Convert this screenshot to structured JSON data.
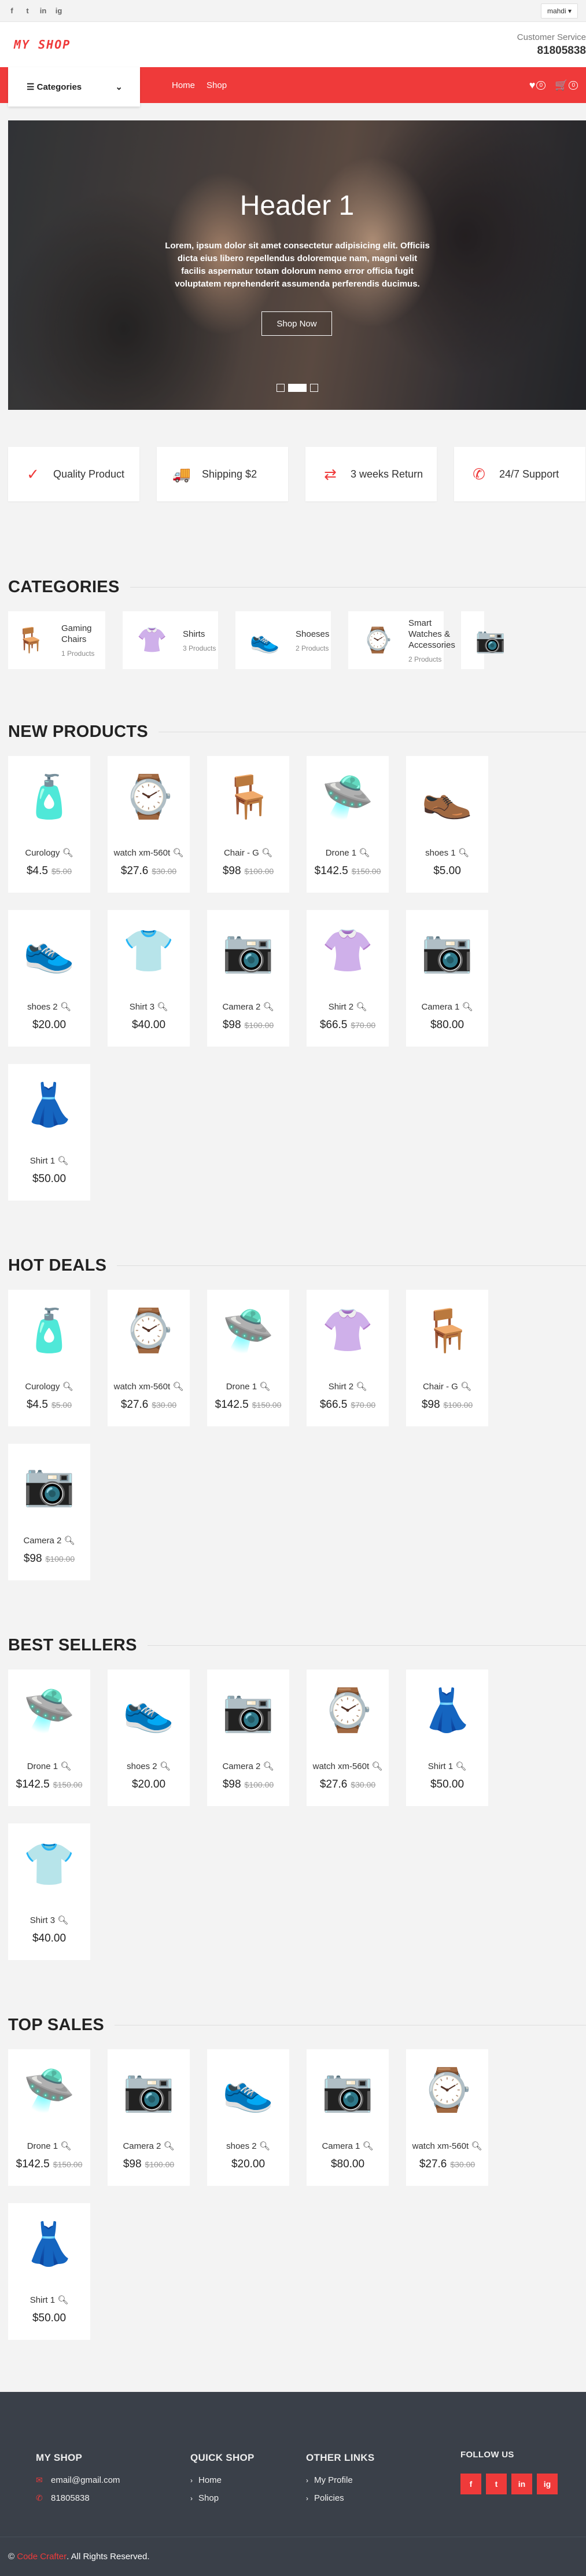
{
  "topbar": {
    "social": [
      "f",
      "t",
      "in",
      "ig"
    ],
    "user_label": "mahdi ▾"
  },
  "header": {
    "logo": "MY SHOP",
    "cs_label": "Customer Service",
    "cs_phone": "81805838"
  },
  "nav": {
    "categories_label": "Categories",
    "links": [
      "Home",
      "Shop"
    ],
    "wishlist_count": "0",
    "cart_count": "0"
  },
  "hero": {
    "title": "Header 1",
    "text": "Lorem, ipsum dolor sit amet consectetur adipisicing elit. Officiis dicta eius libero repellendus doloremque nam, magni velit facilis aspernatur totam dolorum nemo error officia fugit voluptatem reprehenderit assumenda perferendis ducimus.",
    "button": "Shop Now"
  },
  "features": [
    {
      "icon": "check-icon",
      "glyph": "✓",
      "text": "Quality Product"
    },
    {
      "icon": "truck-icon",
      "glyph": "🚚",
      "text": "Shipping $2"
    },
    {
      "icon": "exchange-icon",
      "glyph": "⇄",
      "text": "3 weeks Return"
    },
    {
      "icon": "phone-icon",
      "glyph": "✆",
      "text": "24/7 Support"
    }
  ],
  "sections": {
    "categories": "CATEGORIES",
    "new_products": "NEW PRODUCTS",
    "hot_deals": "HOT DEALS",
    "best_sellers": "BEST SELLERS",
    "top_sales": "TOP SALES"
  },
  "categories": [
    {
      "name": "Gaming Chairs",
      "count": "1 Products",
      "glyph": "🪑"
    },
    {
      "name": "Shirts",
      "count": "3 Products",
      "glyph": "👚"
    },
    {
      "name": "Shoeses",
      "count": "2 Products",
      "glyph": "👟"
    },
    {
      "name": "Smart Watches & Accessories",
      "count": "2 Products",
      "glyph": "⌚"
    },
    {
      "name": "",
      "count": "",
      "glyph": "📷"
    }
  ],
  "new_products": [
    {
      "name": "Curology",
      "price": "$4.5",
      "old": "$5.00",
      "glyph": "🧴"
    },
    {
      "name": "watch xm-560t",
      "price": "$27.6",
      "old": "$30.00",
      "glyph": "⌚"
    },
    {
      "name": "Chair - G",
      "price": "$98",
      "old": "$100.00",
      "glyph": "🪑"
    },
    {
      "name": "Drone 1",
      "price": "$142.5",
      "old": "$150.00",
      "glyph": "🛸"
    },
    {
      "name": "shoes 1",
      "price": "$5.00",
      "old": "",
      "glyph": "👞"
    },
    {
      "name": "shoes 2",
      "price": "$20.00",
      "old": "",
      "glyph": "👟"
    },
    {
      "name": "Shirt 3",
      "price": "$40.00",
      "old": "",
      "glyph": "👕"
    },
    {
      "name": "Camera 2",
      "price": "$98",
      "old": "$100.00",
      "glyph": "📷"
    },
    {
      "name": "Shirt 2",
      "price": "$66.5",
      "old": "$70.00",
      "glyph": "👚"
    },
    {
      "name": "Camera 1",
      "price": "$80.00",
      "old": "",
      "glyph": "📷"
    },
    {
      "name": "Shirt 1",
      "price": "$50.00",
      "old": "",
      "glyph": "👗"
    }
  ],
  "hot_deals": [
    {
      "name": "Curology",
      "price": "$4.5",
      "old": "$5.00",
      "glyph": "🧴"
    },
    {
      "name": "watch xm-560t",
      "price": "$27.6",
      "old": "$30.00",
      "glyph": "⌚"
    },
    {
      "name": "Drone 1",
      "price": "$142.5",
      "old": "$150.00",
      "glyph": "🛸"
    },
    {
      "name": "Shirt 2",
      "price": "$66.5",
      "old": "$70.00",
      "glyph": "👚"
    },
    {
      "name": "Chair - G",
      "price": "$98",
      "old": "$100.00",
      "glyph": "🪑"
    },
    {
      "name": "Camera 2",
      "price": "$98",
      "old": "$100.00",
      "glyph": "📷"
    }
  ],
  "best_sellers": [
    {
      "name": "Drone 1",
      "price": "$142.5",
      "old": "$150.00",
      "glyph": "🛸"
    },
    {
      "name": "shoes 2",
      "price": "$20.00",
      "old": "",
      "glyph": "👟"
    },
    {
      "name": "Camera 2",
      "price": "$98",
      "old": "$100.00",
      "glyph": "📷"
    },
    {
      "name": "watch xm-560t",
      "price": "$27.6",
      "old": "$30.00",
      "glyph": "⌚"
    },
    {
      "name": "Shirt 1",
      "price": "$50.00",
      "old": "",
      "glyph": "👗"
    },
    {
      "name": "Shirt 3",
      "price": "$40.00",
      "old": "",
      "glyph": "👕"
    }
  ],
  "top_sales": [
    {
      "name": "Drone 1",
      "price": "$142.5",
      "old": "$150.00",
      "glyph": "🛸"
    },
    {
      "name": "Camera 2",
      "price": "$98",
      "old": "$100.00",
      "glyph": "📷"
    },
    {
      "name": "shoes 2",
      "price": "$20.00",
      "old": "",
      "glyph": "👟"
    },
    {
      "name": "Camera 1",
      "price": "$80.00",
      "old": "",
      "glyph": "📷"
    },
    {
      "name": "watch xm-560t",
      "price": "$27.6",
      "old": "$30.00",
      "glyph": "⌚"
    },
    {
      "name": "Shirt 1",
      "price": "$50.00",
      "old": "",
      "glyph": "👗"
    }
  ],
  "footer": {
    "shop_title": "MY SHOP",
    "email": "email@gmail.com",
    "phone": "81805838",
    "quick_title": "QUICK SHOP",
    "quick_links": [
      "Home",
      "Shop"
    ],
    "other_title": "OTHER LINKS",
    "other_links": [
      "My Profile",
      "Policies"
    ],
    "follow_title": "FOLLOW US",
    "follow_icons": [
      "f",
      "t",
      "in",
      "ig"
    ],
    "copyright_brand": "Code Crafter",
    "copyright_text": ". All Rights Reserved.",
    "copyright_symbol": "©"
  },
  "colors": {
    "accent": "#ef3a3a",
    "footer_bg": "#3a4049",
    "page_bg": "#f3f3f3"
  }
}
